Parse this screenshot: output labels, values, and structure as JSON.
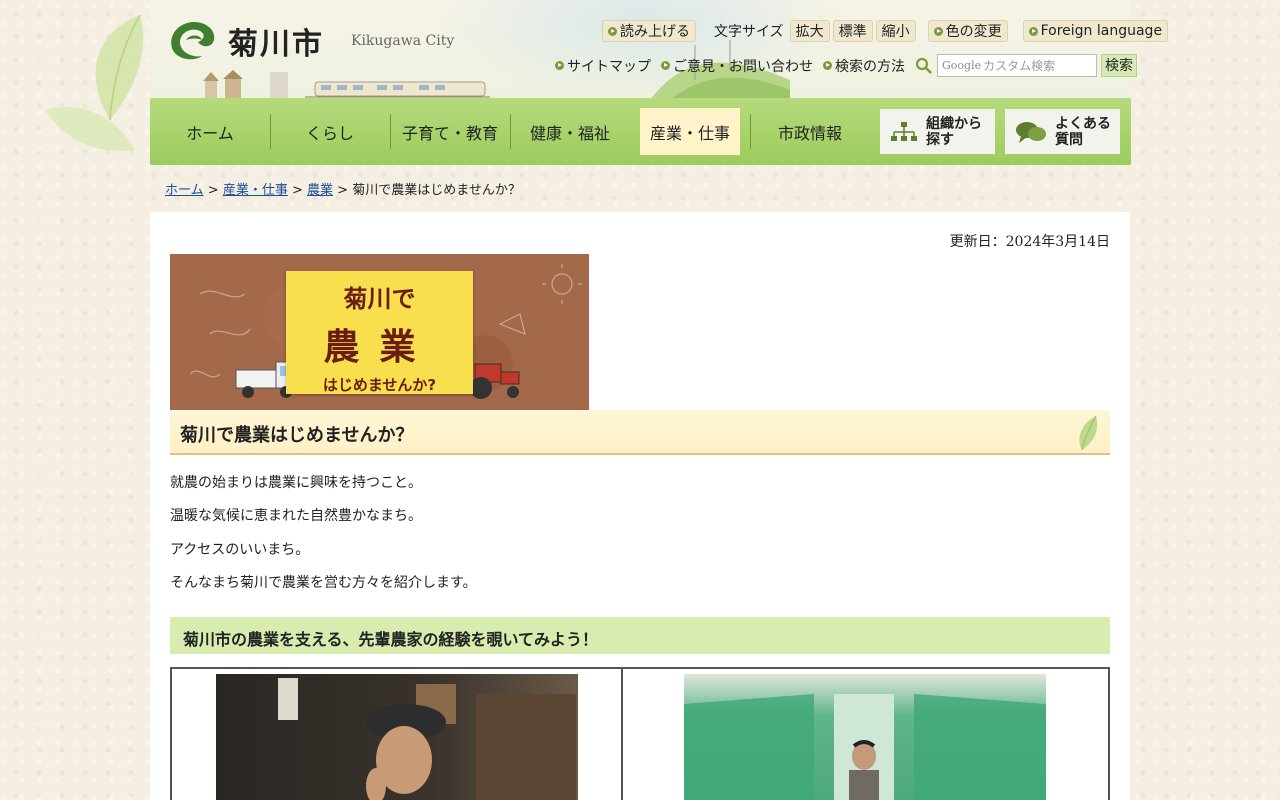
{
  "site": {
    "name_jp": "菊川市",
    "name_en": "Kikugawa City"
  },
  "utility": {
    "read_aloud": "読み上げる",
    "font_size_label": "文字サイズ",
    "font_enlarge": "拡大",
    "font_standard": "標準",
    "font_shrink": "縮小",
    "color_change": "色の変更",
    "foreign_language": "Foreign language",
    "sitemap": "サイトマップ",
    "feedback": "ご意見・お問い合わせ",
    "search_howto": "検索の方法",
    "search_placeholder": "カスタム検索",
    "search_brand": "Google",
    "search_button": "検索"
  },
  "nav": {
    "items": [
      "ホーム",
      "くらし",
      "子育て・教育",
      "健康・福祉",
      "産業・仕事",
      "市政情報"
    ],
    "active_index": 4,
    "org_search": [
      "組織から",
      "探す"
    ],
    "faq": [
      "よくある",
      "質問"
    ]
  },
  "breadcrumb": {
    "items": [
      "ホーム",
      "産業・仕事",
      "農業"
    ],
    "current": "菊川で農業はじめませんか？",
    "separator": ">"
  },
  "page": {
    "updated": "更新日：2024年3月14日",
    "banner": {
      "line1": "菊川で",
      "line2": "農業",
      "line3": "はじめませんか?"
    },
    "title": "菊川で農業はじめませんか？",
    "paragraphs": [
      "就農の始まりは農業に興味を持つこと。",
      "温暖な気候に恵まれた自然豊かなまち。",
      "アクセスのいいまち。",
      "そんなまち菊川で農業を営む方々を紹介します。"
    ],
    "section_title": "菊川市の農業を支える、先輩農家の経験を覗いてみよう！"
  },
  "colors": {
    "nav_green": "#9ccc5d",
    "nav_active": "#fff4c9",
    "h1_bg": "#fff0c6",
    "h2_bg": "#d8ecb0",
    "link": "#1a4e9a",
    "page_bg": "#f4efe2"
  }
}
